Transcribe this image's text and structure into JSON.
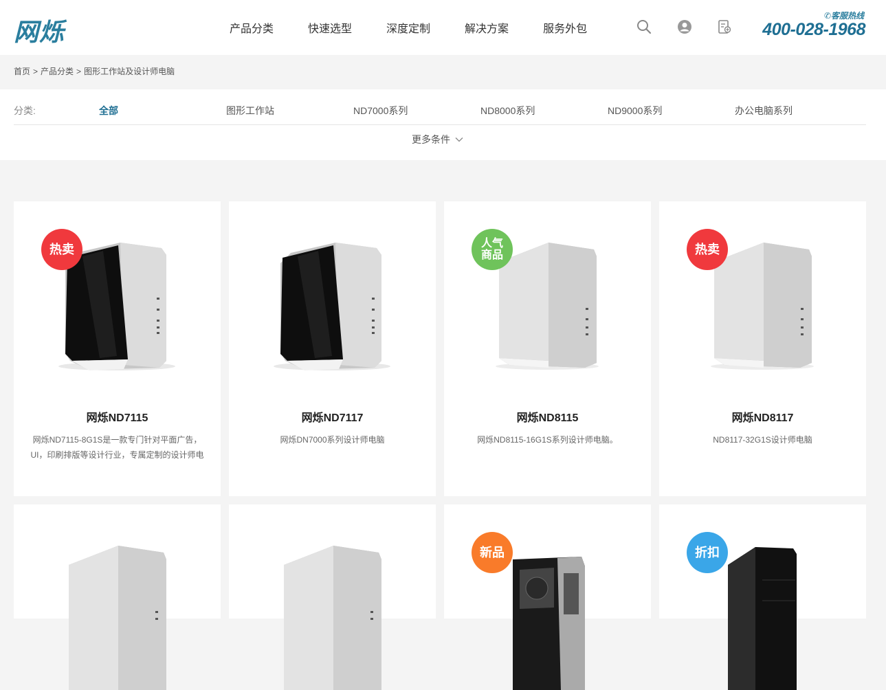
{
  "header": {
    "logo": "网烁",
    "nav": [
      "产品分类",
      "快速选型",
      "深度定制",
      "解决方案",
      "服务外包"
    ],
    "hotline_label": "✆客服热线",
    "hotline_number": "400-028-1968"
  },
  "breadcrumb": [
    "首页",
    "产品分类",
    "图形工作站及设计师电脑"
  ],
  "filter": {
    "label": "分类:",
    "options": [
      "全部",
      "图形工作站",
      "ND7000系列",
      "ND8000系列",
      "ND9000系列",
      "办公电脑系列"
    ],
    "active": "全部",
    "more": "更多条件"
  },
  "products": [
    {
      "title": "网烁ND7115",
      "desc": "网烁ND7115-8G1S是一款专门针对平面广告，UI，印刷排版等设计行业，专属定制的设计师电",
      "badge": "热卖",
      "badge_color": "#f0393d"
    },
    {
      "title": "网烁ND7117",
      "desc": "网烁DN7000系列设计师电脑",
      "badge": "",
      "badge_color": ""
    },
    {
      "title": "网烁ND8115",
      "desc": "网烁ND8115-16G1S系列设计师电脑。",
      "badge": "人气商品",
      "badge_color": "#6fc35b"
    },
    {
      "title": "网烁ND8117",
      "desc": "ND8117-32G1S设计师电脑",
      "badge": "热卖",
      "badge_color": "#f0393d"
    },
    {
      "title": "",
      "desc": "",
      "badge": "",
      "badge_color": ""
    },
    {
      "title": "",
      "desc": "",
      "badge": "",
      "badge_color": ""
    },
    {
      "title": "",
      "desc": "",
      "badge": "新品",
      "badge_color": "#f97b2a"
    },
    {
      "title": "",
      "desc": "",
      "badge": "折扣",
      "badge_color": "#3aa6e8"
    }
  ],
  "icons": [
    "search-icon",
    "user-icon",
    "register-icon"
  ],
  "colors": {
    "accent": "#1f6f93",
    "logo": "#2a7e9e"
  }
}
